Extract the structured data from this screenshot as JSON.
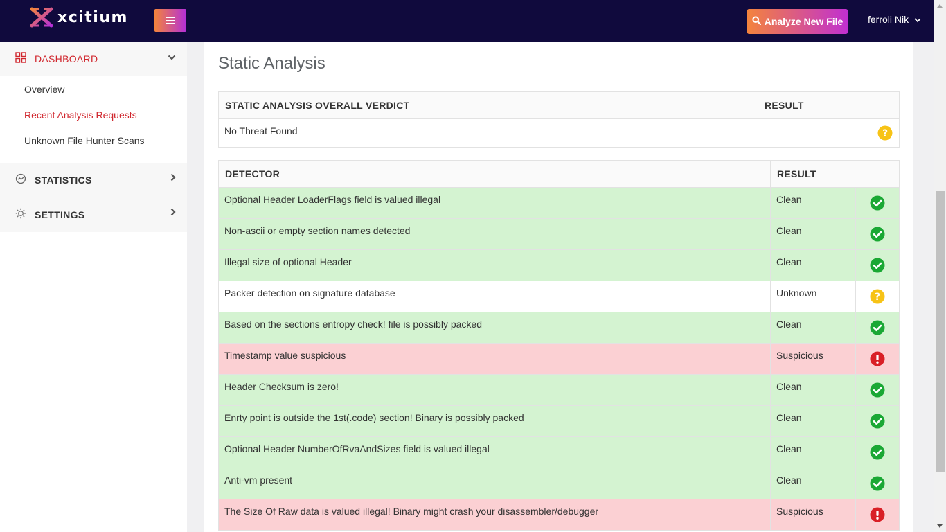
{
  "header": {
    "brand": "xcitium",
    "analyze_button": "Analyze New File",
    "user_name": "ferroli Nik"
  },
  "sidebar": {
    "dashboard": {
      "label": "DASHBOARD",
      "items": [
        "Overview",
        "Recent Analysis Requests",
        "Unknown File Hunter Scans"
      ]
    },
    "statistics": "STATISTICS",
    "settings": "SETTINGS"
  },
  "main": {
    "title": "Static Analysis",
    "verdict_table": {
      "col_verdict": "STATIC ANALYSIS OVERALL VERDICT",
      "col_result": "RESULT",
      "verdict_value": "No Threat Found"
    },
    "detector_table": {
      "col_detector": "DETECTOR",
      "col_result": "RESULT",
      "rows": [
        {
          "detector": "Optional Header LoaderFlags field is valued illegal",
          "result": "Clean"
        },
        {
          "detector": "Non-ascii or empty section names detected",
          "result": "Clean"
        },
        {
          "detector": "Illegal size of optional Header",
          "result": "Clean"
        },
        {
          "detector": "Packer detection on signature database",
          "result": "Unknown"
        },
        {
          "detector": "Based on the sections entropy check! file is possibly packed",
          "result": "Clean"
        },
        {
          "detector": "Timestamp value suspicious",
          "result": "Suspicious"
        },
        {
          "detector": "Header Checksum is zero!",
          "result": "Clean"
        },
        {
          "detector": "Enrty point is outside the 1st(.code) section! Binary is possibly packed",
          "result": "Clean"
        },
        {
          "detector": "Optional Header NumberOfRvaAndSizes field is valued illegal",
          "result": "Clean"
        },
        {
          "detector": "Anti-vm present",
          "result": "Clean"
        },
        {
          "detector": "The Size Of Raw data is valued illegal! Binary might crash your disassembler/debugger",
          "result": "Suspicious"
        }
      ]
    }
  },
  "colors": {
    "topbar": "#100a3d",
    "accent_red": "#d0262d",
    "clean_row": "#d4f3d1",
    "suspicious_row": "#fbd0d3",
    "check_green": "#1aa834",
    "alert_red": "#d91f26",
    "unknown_yellow": "#f7c316"
  }
}
